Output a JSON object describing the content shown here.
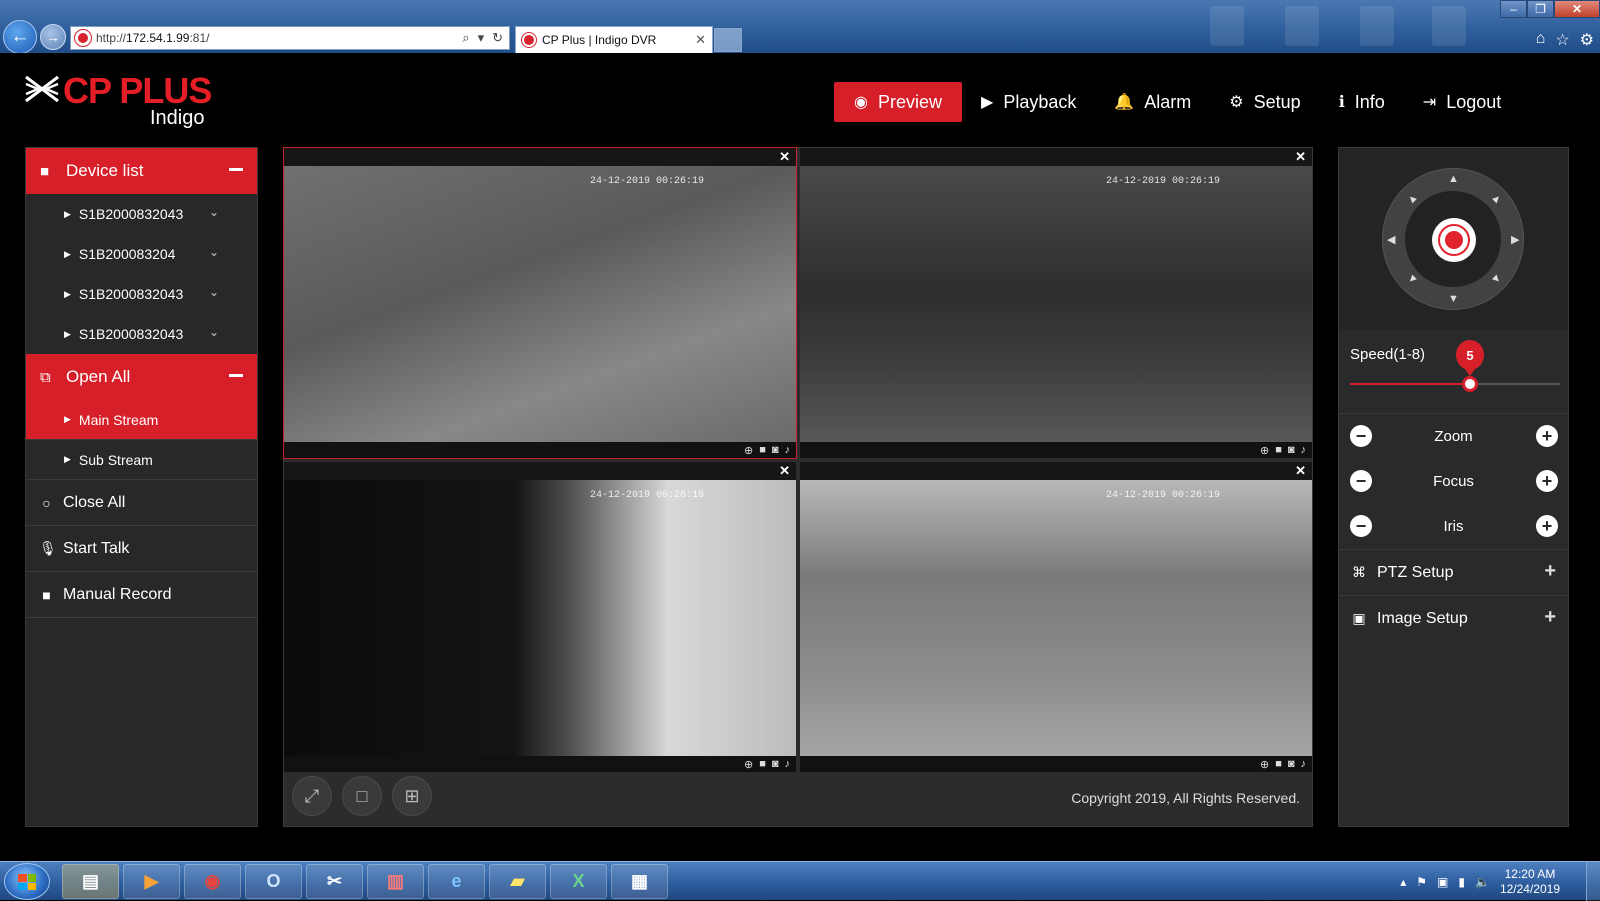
{
  "browser": {
    "url_prefix": "http://",
    "url_host": "172.54.1.99",
    "url_port": ":81/",
    "tab_title": "CP Plus | Indigo DVR",
    "tab_close": "✕",
    "search_icon": "⌕",
    "refresh_icon": "↻",
    "window_minimize": "–",
    "window_restore": "❐",
    "window_close": "✕"
  },
  "brand": {
    "name": "CP PLUS",
    "product": "Indigo",
    "color": "#e31e26"
  },
  "nav": [
    {
      "label": "Preview",
      "icon": "eye-icon",
      "glyph": "◉",
      "active": true
    },
    {
      "label": "Playback",
      "icon": "play-icon",
      "glyph": "▶"
    },
    {
      "label": "Alarm",
      "icon": "bell-icon",
      "glyph": "🔔"
    },
    {
      "label": "Setup",
      "icon": "gear-icon",
      "glyph": "⚙"
    },
    {
      "label": "Info",
      "icon": "info-icon",
      "glyph": "ℹ"
    },
    {
      "label": "Logout",
      "icon": "logout-icon",
      "glyph": "⇥"
    }
  ],
  "sidebar": {
    "device_list_label": "Device list",
    "devices": [
      {
        "name": "S1B2000832043"
      },
      {
        "name": "S1B200083204"
      },
      {
        "name": "S1B2000832043"
      },
      {
        "name": "S1B2000832043"
      }
    ],
    "open_all_label": "Open All",
    "streams": [
      {
        "label": "Main Stream",
        "active": true
      },
      {
        "label": "Sub Stream",
        "active": false
      }
    ],
    "close_all_label": "Close All",
    "start_talk_label": "Start Talk",
    "manual_record_label": "Manual Record"
  },
  "cameras": [
    {
      "timestamp": "24-12-2019 00:26:19",
      "selected": true
    },
    {
      "timestamp": "24-12-2019 00:26:19",
      "selected": false
    },
    {
      "timestamp": "24-12-2019 00:26:19",
      "selected": false
    },
    {
      "timestamp": "24-12-2019 00:26:19",
      "selected": false
    }
  ],
  "footer": {
    "copyright": "Copyright 2019, All Rights Reserved."
  },
  "ptz": {
    "speed_label": "Speed(1-8)",
    "speed_value": "5",
    "speed_min": 1,
    "speed_max": 8,
    "zoom_label": "Zoom",
    "focus_label": "Focus",
    "iris_label": "Iris",
    "ptz_setup_label": "PTZ Setup",
    "image_setup_label": "Image Setup"
  },
  "taskbar": {
    "time": "12:20 AM",
    "date": "12/24/2019",
    "apps": [
      "file-explorer-icon",
      "media-player-icon",
      "chrome-icon",
      "outlook-icon",
      "snipping-tool-icon",
      "winrar-icon",
      "internet-explorer-icon",
      "sticky-notes-icon",
      "excel-icon",
      "window-app-icon"
    ]
  },
  "colors": {
    "accent": "#d71f29",
    "panel": "#2a2a2a",
    "background": "#000000"
  }
}
